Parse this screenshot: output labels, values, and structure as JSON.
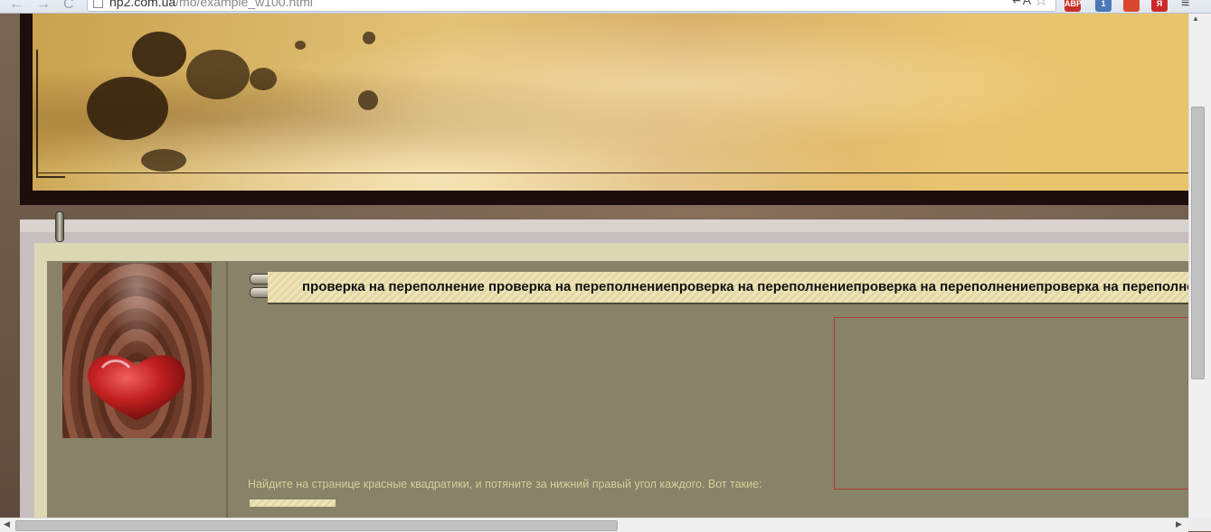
{
  "browser": {
    "back_icon": "←",
    "forward_icon": "→",
    "reload_icon": "C",
    "url_host": "np2.com.ua",
    "url_path": "/mo/example_w100.html",
    "translate_icon": "↵A",
    "star_icon": "☆",
    "extensions": [
      {
        "name": "adblock-icon",
        "label": "ABP",
        "color": "#c9302c"
      },
      {
        "name": "mail-icon",
        "label": "1",
        "color": "#4a78b8"
      },
      {
        "name": "fox-icon",
        "label": "",
        "color": "#d9482e"
      },
      {
        "name": "yandex-icon",
        "label": "Я",
        "color": "#cc2a2a"
      }
    ],
    "menu_icon": "≡"
  },
  "main": {
    "title": "проверка на переполнение проверка на переполнениепроверка на переполнениепроверка на переполнениепроверка на переполнение",
    "hint": "Найдите на странице красные квадратики, и потяните за нижний правый угол каждого. Вот такие:"
  },
  "colors": {
    "accent": "#b13a36",
    "panel": "#878268",
    "header_gold": "#e3c278"
  }
}
